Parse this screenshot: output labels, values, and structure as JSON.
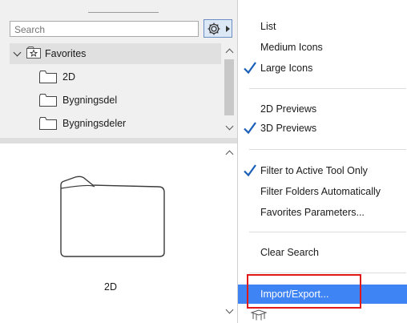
{
  "search": {
    "placeholder": "Search",
    "value": "Search"
  },
  "tree": {
    "items": [
      {
        "label": "Favorites",
        "type": "favorites",
        "expanded": true
      },
      {
        "label": "2D",
        "type": "folder"
      },
      {
        "label": "Bygningsdel",
        "type": "folder"
      },
      {
        "label": "Bygningsdeler",
        "type": "folder"
      }
    ]
  },
  "preview": {
    "label": "2D"
  },
  "menu": {
    "items": [
      {
        "label": "List",
        "checked": false
      },
      {
        "label": "Medium Icons",
        "checked": false
      },
      {
        "label": "Large Icons",
        "checked": true
      },
      {
        "label": "2D Previews",
        "checked": false
      },
      {
        "label": "3D Previews",
        "checked": true
      },
      {
        "label": "Filter to Active Tool Only",
        "checked": true
      },
      {
        "label": "Filter Folders Automatically",
        "checked": false
      },
      {
        "label": "Favorites Parameters...",
        "checked": false
      },
      {
        "label": "Clear Search",
        "checked": false
      },
      {
        "label": "Import/Export...",
        "checked": false,
        "highlighted": true
      }
    ]
  },
  "colors": {
    "highlight": "#3f84f5",
    "callout": "#e01818",
    "check": "#1b5fb8"
  }
}
